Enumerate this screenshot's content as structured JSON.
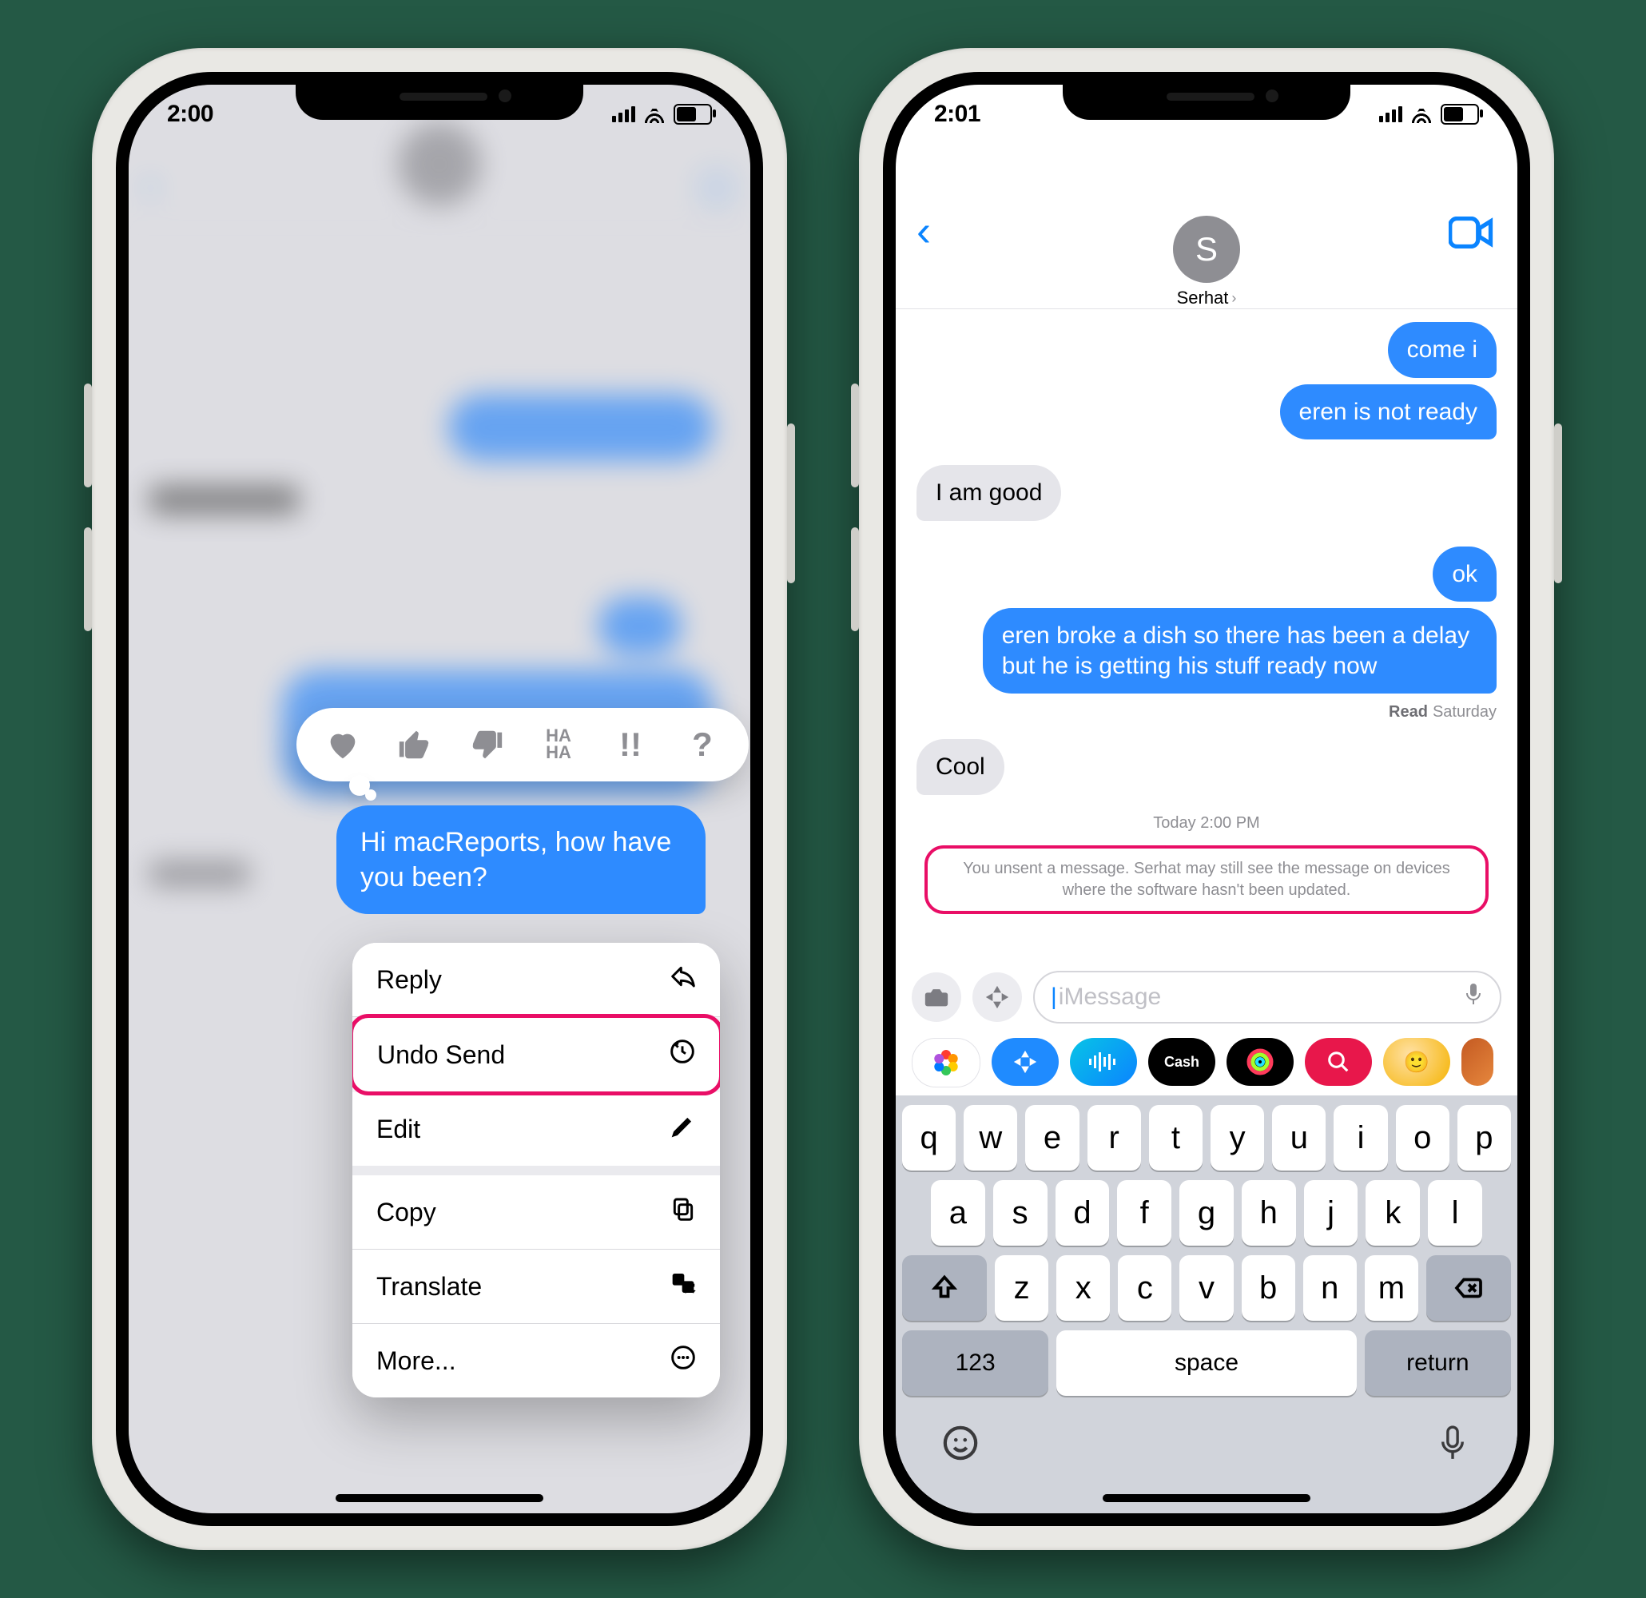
{
  "left": {
    "status_time": "2:00",
    "selected_message": "Hi macReports, how have you been?",
    "tapbacks": [
      "heart",
      "thumbs-up",
      "thumbs-down",
      "haha",
      "exclaim",
      "question"
    ],
    "haha_label": "HA HA",
    "exclaim_label": "!!",
    "question_label": "?",
    "menu": {
      "reply": "Reply",
      "undo_send": "Undo Send",
      "edit": "Edit",
      "copy": "Copy",
      "translate": "Translate",
      "more": "More..."
    }
  },
  "right": {
    "status_time": "2:01",
    "contact_name": "Serhat",
    "avatar_initial": "S",
    "messages": {
      "m1": "come i",
      "m2": "eren is not ready",
      "m3": "I am good",
      "m4": "ok",
      "m5": "eren broke a dish so there has been a delay but he is getting his stuff ready now",
      "m6": "Cool"
    },
    "read_label": "Read",
    "read_day": "Saturday",
    "timestamp": "Today 2:00 PM",
    "unsent_notice": "You unsent a message. Serhat may still see the message on devices where the software hasn't been updated.",
    "compose_placeholder": "iMessage",
    "app_chips": [
      {
        "name": "photos",
        "bg": "#ffffff",
        "border": "#e3e3e8"
      },
      {
        "name": "appstore",
        "bg": "#1f8bff"
      },
      {
        "name": "audio",
        "bg": "#05a3c9"
      },
      {
        "name": "applecash",
        "bg": "#000000",
        "text": "Cash"
      },
      {
        "name": "activity",
        "bg": "#000000"
      },
      {
        "name": "search",
        "bg": "#e8174b"
      },
      {
        "name": "memoji",
        "bg": "#f5b301"
      },
      {
        "name": "more",
        "bg": "#8e8e93"
      }
    ],
    "keyboard": {
      "row1": [
        "q",
        "w",
        "e",
        "r",
        "t",
        "y",
        "u",
        "i",
        "o",
        "p"
      ],
      "row2": [
        "a",
        "s",
        "d",
        "f",
        "g",
        "h",
        "j",
        "k",
        "l"
      ],
      "row3": [
        "z",
        "x",
        "c",
        "v",
        "b",
        "n",
        "m"
      ],
      "numbers": "123",
      "space": "space",
      "return": "return"
    }
  }
}
